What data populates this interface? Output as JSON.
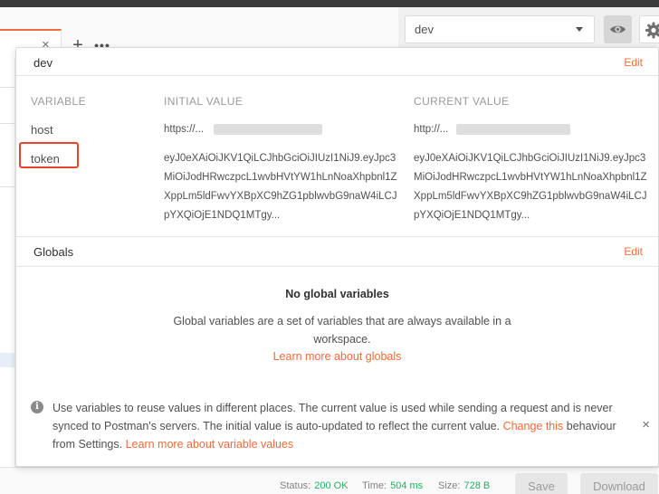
{
  "tabs": {
    "close_glyph": "×",
    "add_glyph": "+",
    "more_glyph": "•••"
  },
  "environment_selector": {
    "selected": "dev"
  },
  "popover": {
    "env_name": "dev",
    "edit_label": "Edit",
    "columns": {
      "variable": "VARIABLE",
      "initial": "INITIAL VALUE",
      "current": "CURRENT VALUE"
    },
    "variables": [
      {
        "name": "host",
        "initial": "https://...",
        "current": "http://..."
      },
      {
        "name": "token",
        "initial": "eyJ0eXAiOiJKV1QiLCJhbGciOiJIUzI1NiJ9.eyJpc3MiOiJodHRwczpcL1wvbHVtYW1hLnNoaXhpbnl1ZXppLm5ldFwvYXBpXC9hZG1pblwvbG9naW4iLCJpYXQiOjE1NDQ1MTgy...",
        "current": "eyJ0eXAiOiJKV1QiLCJhbGciOiJIUzI1NiJ9.eyJpc3MiOiJodHRwczpcL1wvbHVtYW1hLnNoaXhpbnl1ZXppLm5ldFwvYXBpXC9hZG1pblwvbG9naW4iLCJpYXQiOjE1NDQ1MTgy..."
      }
    ],
    "globals": {
      "title": "Globals",
      "edit_label": "Edit",
      "empty_title": "No global variables",
      "empty_desc": "Global variables are a set of variables that are always available in a workspace.",
      "learn_more": "Learn more about globals"
    },
    "info": {
      "text_1": "Use variables to reuse values in different places. The current value is used while sending a request and is never synced to Postman's servers. The initial value is auto-updated to reflect the current value. ",
      "link_1": "Change this",
      "text_2": " behaviour from Settings. ",
      "link_2": "Learn more about variable values",
      "close_glyph": "×"
    }
  },
  "status": {
    "status_label": "Status:",
    "status_value": "200 OK",
    "time_label": "Time:",
    "time_value": "504 ms",
    "size_label": "Size:",
    "size_value": "728 B",
    "save_label": "Save",
    "download_label": "Download"
  },
  "colors": {
    "accent": "#f26b3a",
    "ok": "#27ae60",
    "highlight": "#e8432c"
  }
}
